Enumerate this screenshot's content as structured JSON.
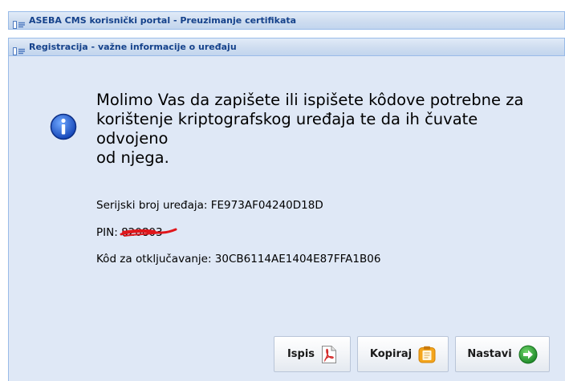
{
  "window": {
    "title": "ASEBA CMS korisnički portal - Preuzimanje certifikata"
  },
  "section": {
    "title": "Registracija - važne informacije o uređaju"
  },
  "message": {
    "line1": "Molimo Vas da zapišete ili ispišete kôdove potrebne za",
    "line2": "korištenje kriptografskog uređaja te da ih čuvate odvojeno",
    "line3": "od njega."
  },
  "fields": {
    "serial_label": "Serijski broj uređaja: ",
    "serial_value": "FE973AF04240D18D",
    "pin_label": "PIN: ",
    "pin_value": "820803",
    "unlock_label": "Kôd za otključavanje: ",
    "unlock_value": "30CB6114AE1404E87FFA1B06"
  },
  "buttons": {
    "print_label": "Ispis",
    "copy_label": "Kopiraj",
    "next_label": "Nastavi"
  },
  "colors": {
    "header_title": "#15428b",
    "body_background": "#dfe8f6",
    "pin_redaction": "#e0161b",
    "next_arrow": "#2fa33a"
  },
  "icons": {
    "window": "panel-icon",
    "info": "info-icon",
    "print": "pdf-icon",
    "copy": "clipboard-icon",
    "next": "arrow-right-icon"
  }
}
